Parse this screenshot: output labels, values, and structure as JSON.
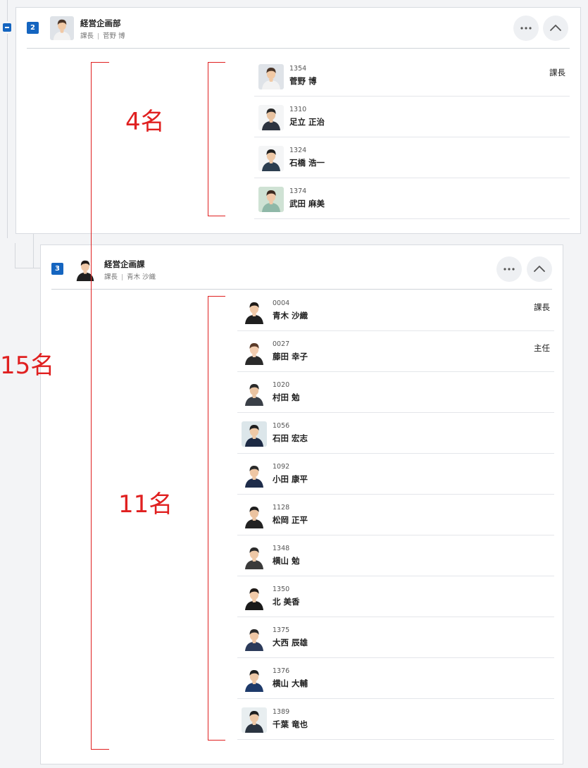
{
  "sections": [
    {
      "level": "2",
      "name": "経営企画部",
      "head_title": "課長",
      "head_name": "菅野 博",
      "members": [
        {
          "id": "1354",
          "name": "菅野 博",
          "role": "課長",
          "avatar_bg": "#dfe3e8",
          "hair": "#4a3528",
          "shirt": "#f2f2f2",
          "skin": "#f1c9a5"
        },
        {
          "id": "1310",
          "name": "足立 正治",
          "role": "",
          "avatar_bg": "#f4f5f6",
          "hair": "#2a2a2a",
          "shirt": "#2e3440",
          "skin": "#e8c2a0"
        },
        {
          "id": "1324",
          "name": "石橋 浩一",
          "role": "",
          "avatar_bg": "#f4f5f6",
          "hair": "#1f1f1f",
          "shirt": "#2c3e50",
          "skin": "#eec8a6"
        },
        {
          "id": "1374",
          "name": "武田 麻美",
          "role": "",
          "avatar_bg": "#cfe2d4",
          "hair": "#3b2a20",
          "shirt": "#8fb8a8",
          "skin": "#f0c8a8"
        }
      ]
    },
    {
      "level": "3",
      "name": "経営企画課",
      "head_title": "課長",
      "head_name": "青木 沙織",
      "members": [
        {
          "id": "0004",
          "name": "青木 沙織",
          "role": "課長",
          "avatar_bg": "#ffffff",
          "hair": "#1f1a17",
          "shirt": "#1f1f1f",
          "skin": "#f0c9a8"
        },
        {
          "id": "0027",
          "name": "藤田 幸子",
          "role": "主任",
          "avatar_bg": "#ffffff",
          "hair": "#5a3a28",
          "shirt": "#2a2a2a",
          "skin": "#f2cdb0"
        },
        {
          "id": "1020",
          "name": "村田 勉",
          "role": "",
          "avatar_bg": "#ffffff",
          "hair": "#2a2a2a",
          "shirt": "#3a3f47",
          "skin": "#eac4a2"
        },
        {
          "id": "1056",
          "name": "石田 宏志",
          "role": "",
          "avatar_bg": "#dce6ea",
          "hair": "#1f1f1f",
          "shirt": "#1d2a44",
          "skin": "#eec8a6"
        },
        {
          "id": "1092",
          "name": "小田 康平",
          "role": "",
          "avatar_bg": "#ffffff",
          "hair": "#2a2a2a",
          "shirt": "#1e2c4a",
          "skin": "#eec6a4"
        },
        {
          "id": "1128",
          "name": "松岡 正平",
          "role": "",
          "avatar_bg": "#ffffff",
          "hair": "#1e1e1e",
          "shirt": "#222",
          "skin": "#ebc3a0"
        },
        {
          "id": "1348",
          "name": "横山 勉",
          "role": "",
          "avatar_bg": "#ffffff",
          "hair": "#2a2a2a",
          "shirt": "#3a3a3a",
          "skin": "#eec8a6"
        },
        {
          "id": "1350",
          "name": "北 美香",
          "role": "",
          "avatar_bg": "#ffffff",
          "hair": "#1f1a17",
          "shirt": "#1a1a1a",
          "skin": "#f1caa8"
        },
        {
          "id": "1375",
          "name": "大西 辰雄",
          "role": "",
          "avatar_bg": "#ffffff",
          "hair": "#2a2a2a",
          "shirt": "#2b3a5a",
          "skin": "#eec6a4"
        },
        {
          "id": "1376",
          "name": "横山 大輔",
          "role": "",
          "avatar_bg": "#ffffff",
          "hair": "#1f1f1f",
          "shirt": "#1e3a6a",
          "skin": "#eec8a6"
        },
        {
          "id": "1389",
          "name": "千葉 竜也",
          "role": "",
          "avatar_bg": "#e8eef0",
          "hair": "#1f1f1f",
          "shirt": "#2a3440",
          "skin": "#eec8a6"
        }
      ]
    }
  ],
  "annotations": {
    "total": "15名",
    "section1_count": "4名",
    "section2_count": "11名",
    "color": "#e02020"
  },
  "colors": {
    "badge": "#1565c0",
    "divider": "#cfd3d8",
    "button_bg": "#eef0f3"
  }
}
